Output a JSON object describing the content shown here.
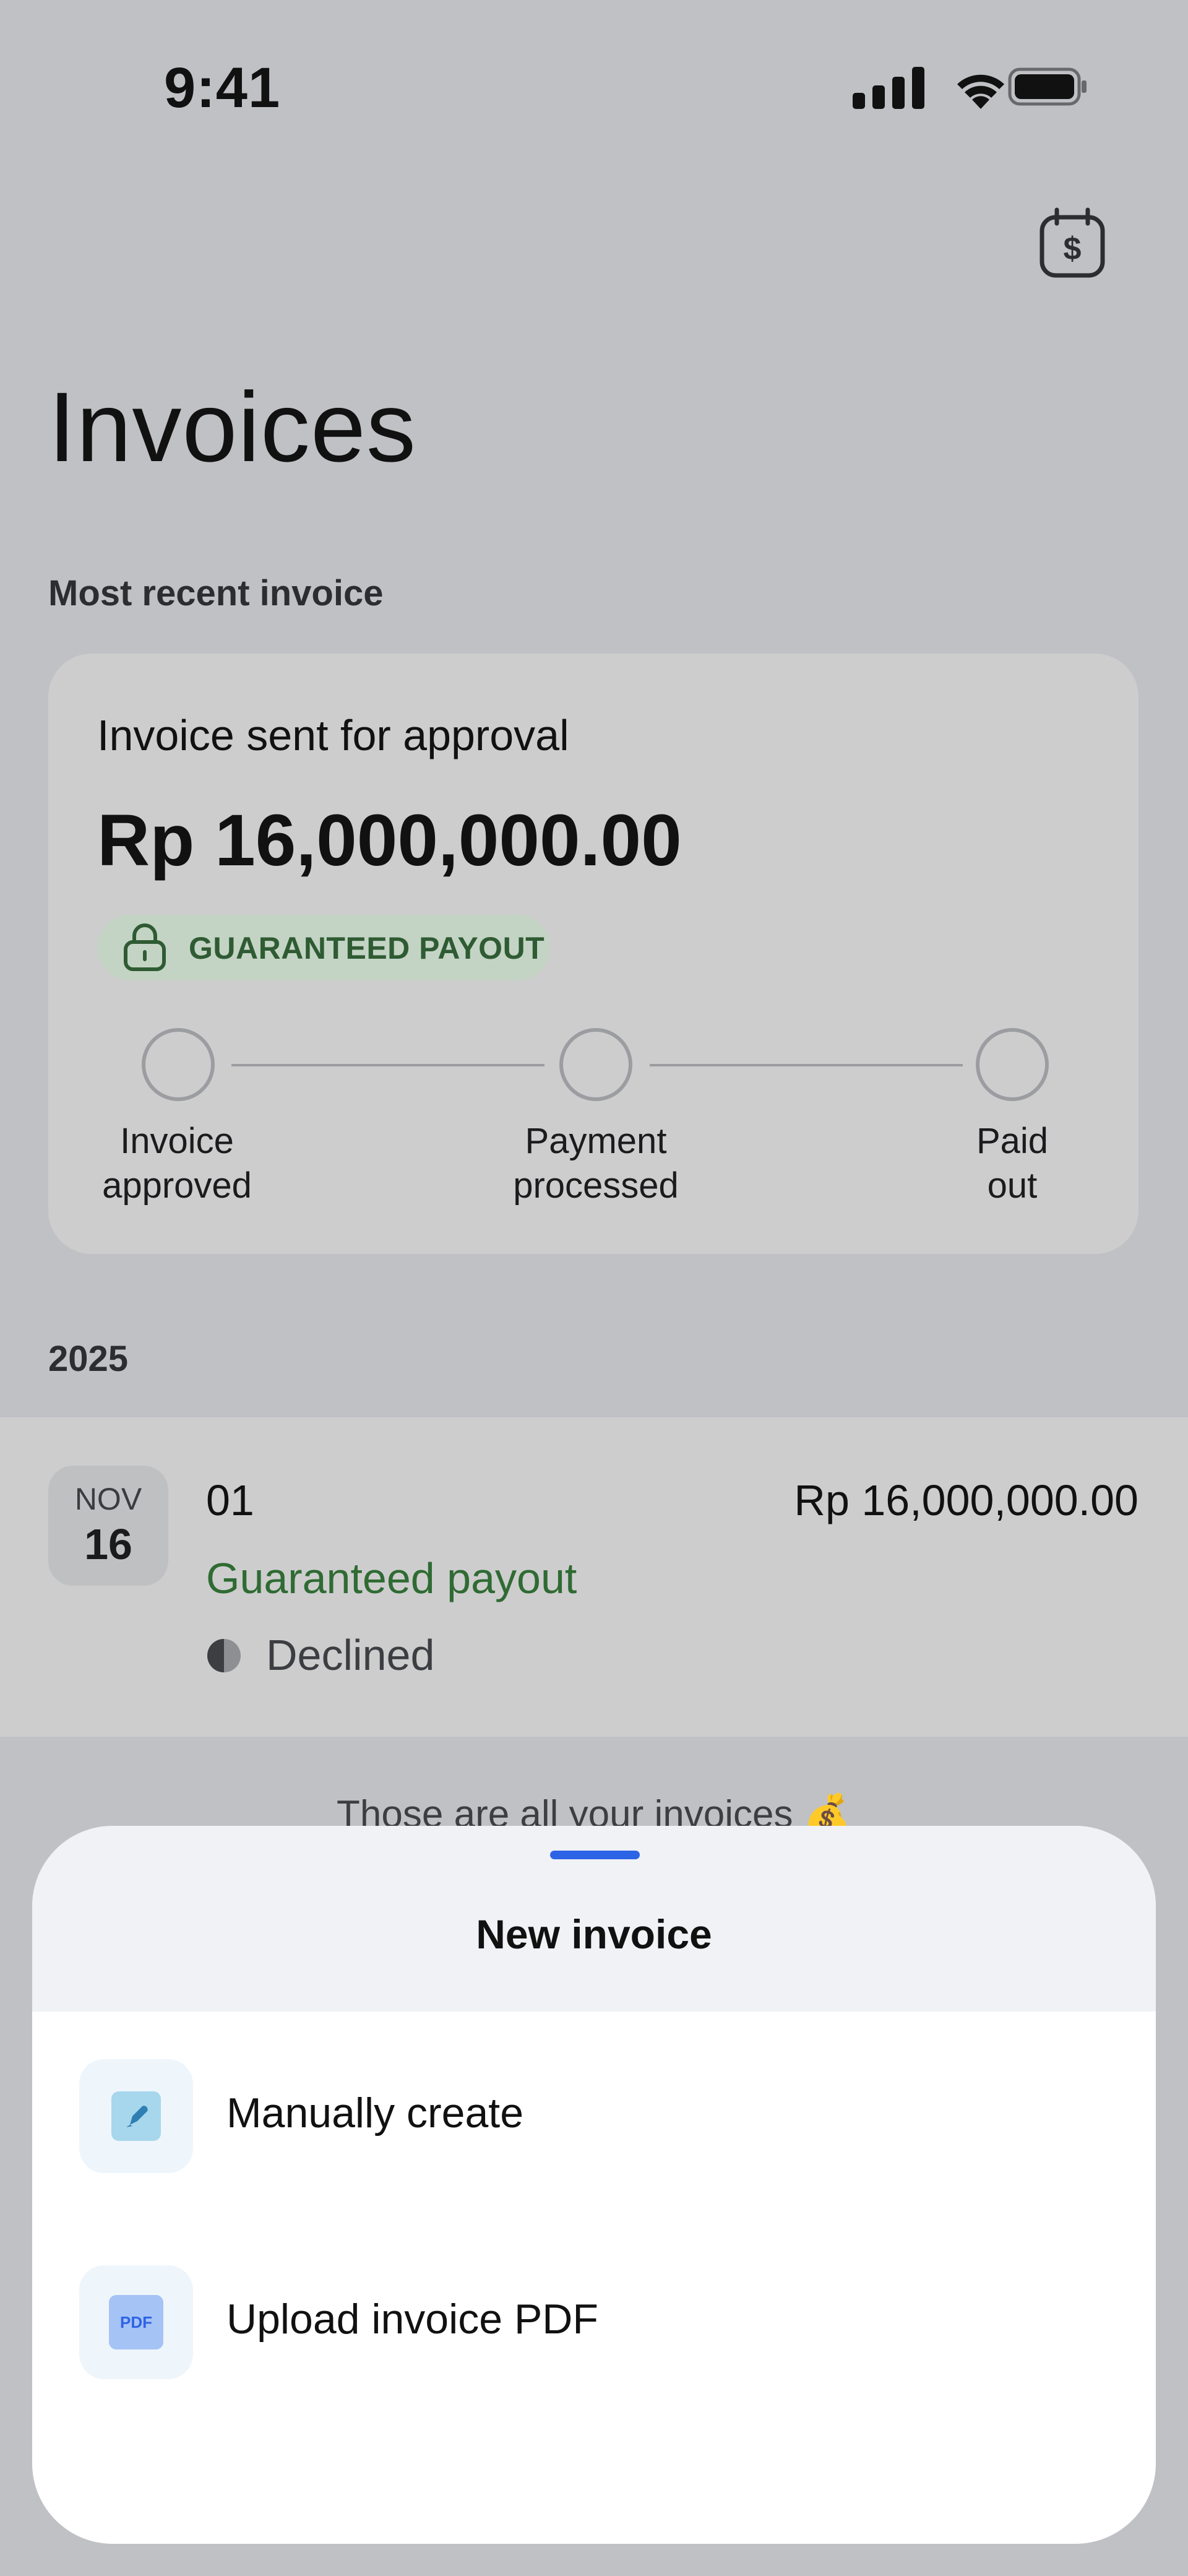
{
  "status_bar": {
    "time": "9:41"
  },
  "header": {
    "title": "Invoices",
    "calendar_icon": "calendar-dollar-icon"
  },
  "recent": {
    "section_label": "Most recent invoice",
    "status_text": "Invoice sent for approval",
    "amount": "Rp 16,000,000.00",
    "badge": "GUARANTEED PAYOUT",
    "steps": [
      {
        "label_line1": "Invoice",
        "label_line2": "approved"
      },
      {
        "label_line1": "Payment",
        "label_line2": "processed"
      },
      {
        "label_line1": "Paid",
        "label_line2": "out"
      }
    ]
  },
  "year_group": {
    "year": "2025",
    "invoices": [
      {
        "month": "NOV",
        "day": "16",
        "id": "01",
        "amount": "Rp 16,000,000.00",
        "type": "Guaranteed payout",
        "status": "Declined"
      }
    ]
  },
  "footer_note": "Those are all your invoices 💰",
  "sheet": {
    "title": "New invoice",
    "options": [
      {
        "label": "Manually create",
        "icon": "pencil-icon"
      },
      {
        "label": "Upload invoice PDF",
        "icon": "pdf-icon",
        "icon_text": "PDF"
      }
    ]
  },
  "colors": {
    "accent": "#2d64e6",
    "success": "#2f6b33",
    "badge_bg": "#c3d4c4"
  }
}
